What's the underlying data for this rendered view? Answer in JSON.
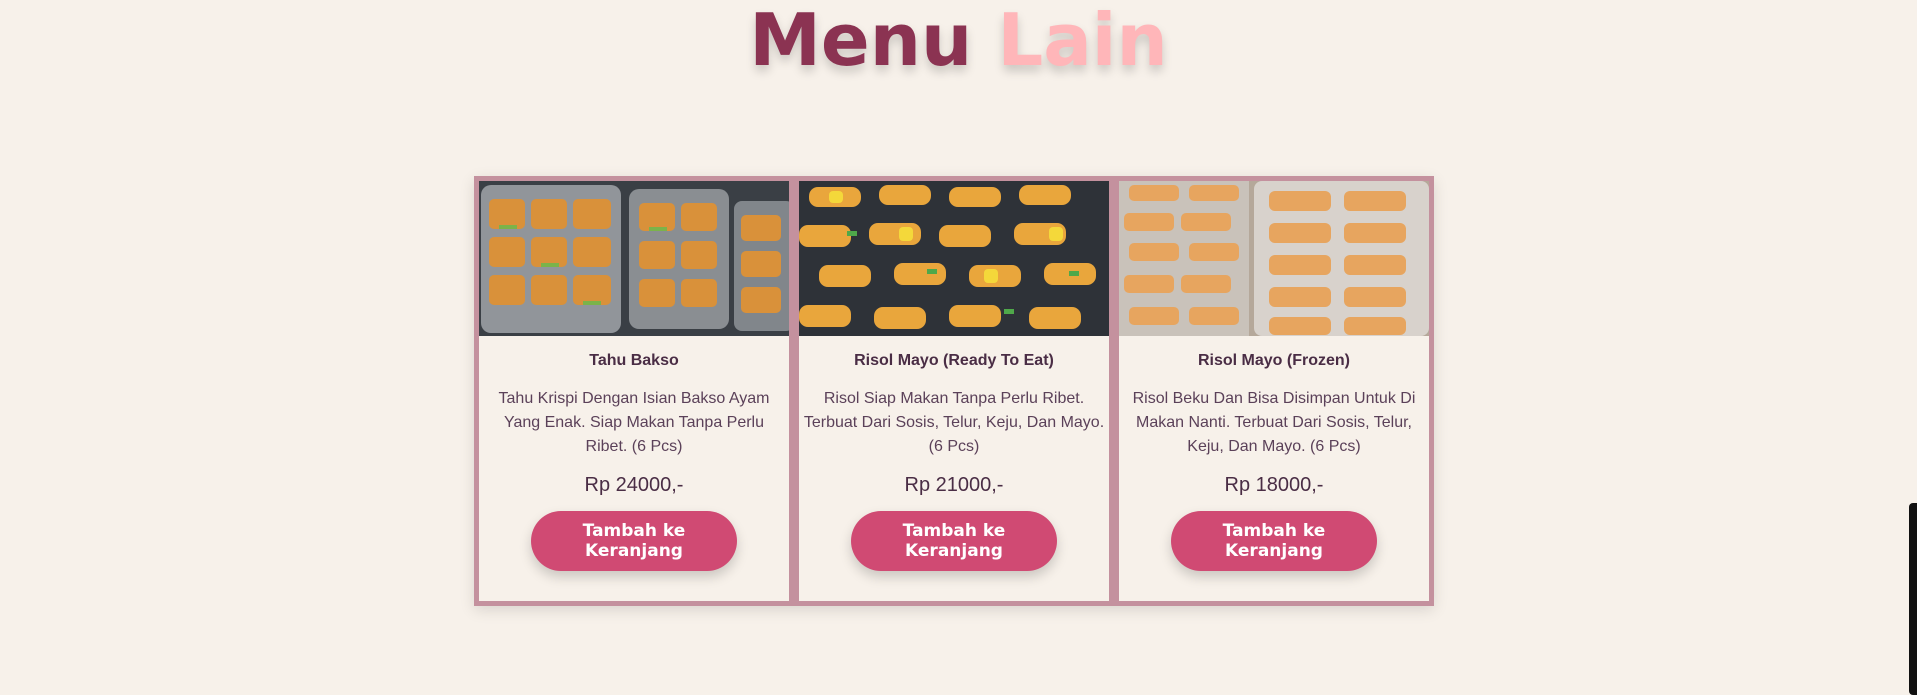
{
  "heading": {
    "word1": "Menu",
    "word2": "Lain"
  },
  "colors": {
    "accent_dark": "#8b3352",
    "accent_light": "#ffb6b9",
    "button": "#d04a73",
    "card_border": "#c4919e",
    "background": "#f7f1ea"
  },
  "products": [
    {
      "name": "Tahu Bakso",
      "description": "Tahu Krispi Dengan Isian Bakso Ayam Yang Enak. Siap Makan Tanpa Perlu Ribet. (6 Pcs)",
      "price": "Rp 24000,-",
      "button_label": "Tambah ke Keranjang",
      "image": "fried-tofu-photo"
    },
    {
      "name": "Risol Mayo (Ready To Eat)",
      "description": "Risol Siap Makan Tanpa Perlu Ribet. Terbuat Dari Sosis, Telur, Keju, Dan Mayo. (6 Pcs)",
      "price": "Rp 21000,-",
      "button_label": "Tambah ke Keranjang",
      "image": "risol-mayo-photo"
    },
    {
      "name": "Risol Mayo (Frozen)",
      "description": "Risol Beku Dan Bisa Disimpan Untuk Di Makan Nanti. Terbuat Dari Sosis, Telur, Keju, Dan Mayo. (6 Pcs)",
      "price": "Rp 18000,-",
      "button_label": "Tambah ke Keranjang",
      "image": "frozen-risol-photo"
    }
  ]
}
